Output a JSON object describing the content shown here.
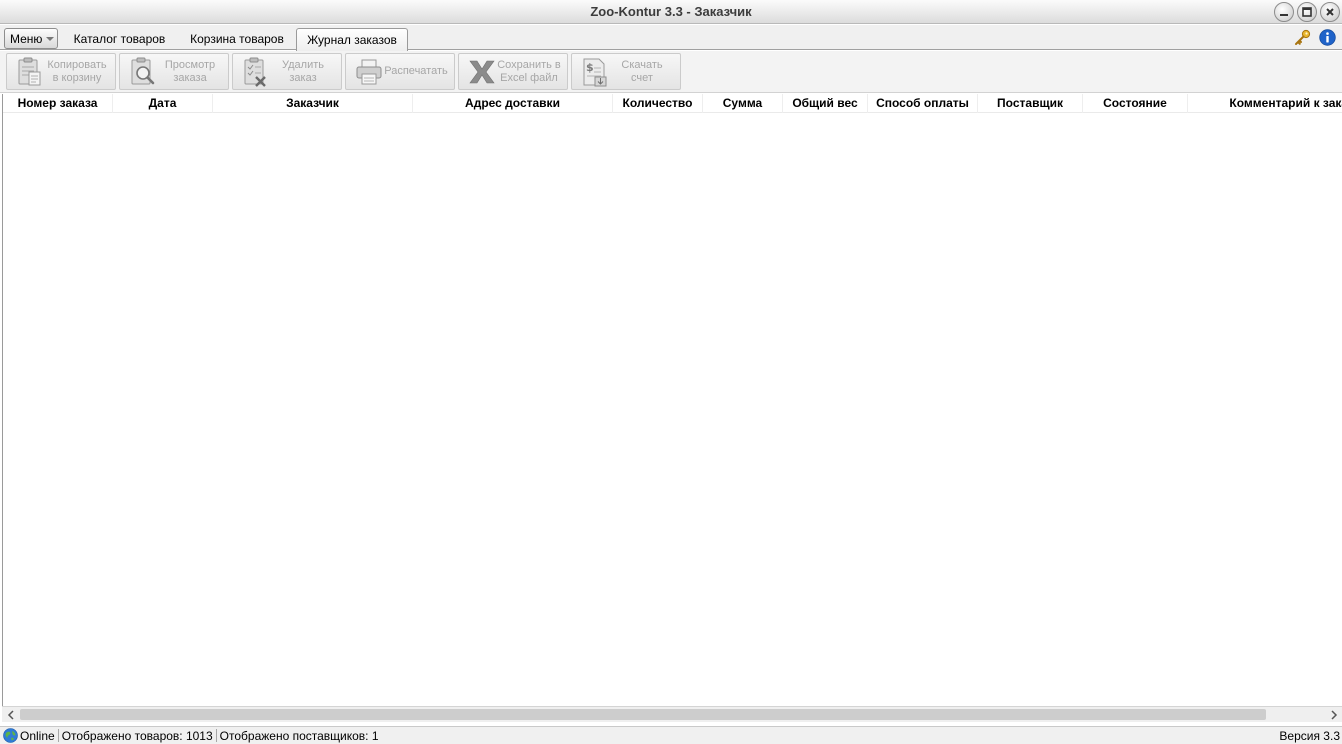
{
  "window": {
    "title": "Zoo-Kontur 3.3 - Заказчик"
  },
  "menu": {
    "label": "Меню"
  },
  "tabs": [
    {
      "label": "Каталог товаров"
    },
    {
      "label": "Корзина товаров"
    },
    {
      "label": "Журнал заказов"
    }
  ],
  "active_tab": "Журнал заказов",
  "toolbar": {
    "copy_line1": "Копировать",
    "copy_line2": "в корзину",
    "view_line1": "Просмотр",
    "view_line2": "заказа",
    "delete_line1": "Удалить",
    "delete_line2": "заказ",
    "print_label": "Распечатать",
    "excel_line1": "Сохранить в",
    "excel_line2": "Excel файл",
    "download_line1": "Скачать",
    "download_line2": "счет"
  },
  "table": {
    "columns": [
      "Номер заказа",
      "Дата",
      "Заказчик",
      "Адрес доставки",
      "Количество",
      "Сумма",
      "Общий вес",
      "Способ оплаты",
      "Поставщик",
      "Состояние",
      "Комментарий к заказу"
    ],
    "rows": []
  },
  "status": {
    "connection": "Online",
    "products_shown": "Отображено товаров: 1013",
    "suppliers_shown": "Отображено поставщиков: 1",
    "version": "Версия 3.3"
  },
  "icons": {
    "key": "key-icon",
    "info": "info-icon",
    "globe": "globe-icon"
  },
  "colors": {
    "info_blue": "#1f63c9",
    "key_gold": "#d9a11c",
    "disabled_text": "#a6a6a6"
  }
}
